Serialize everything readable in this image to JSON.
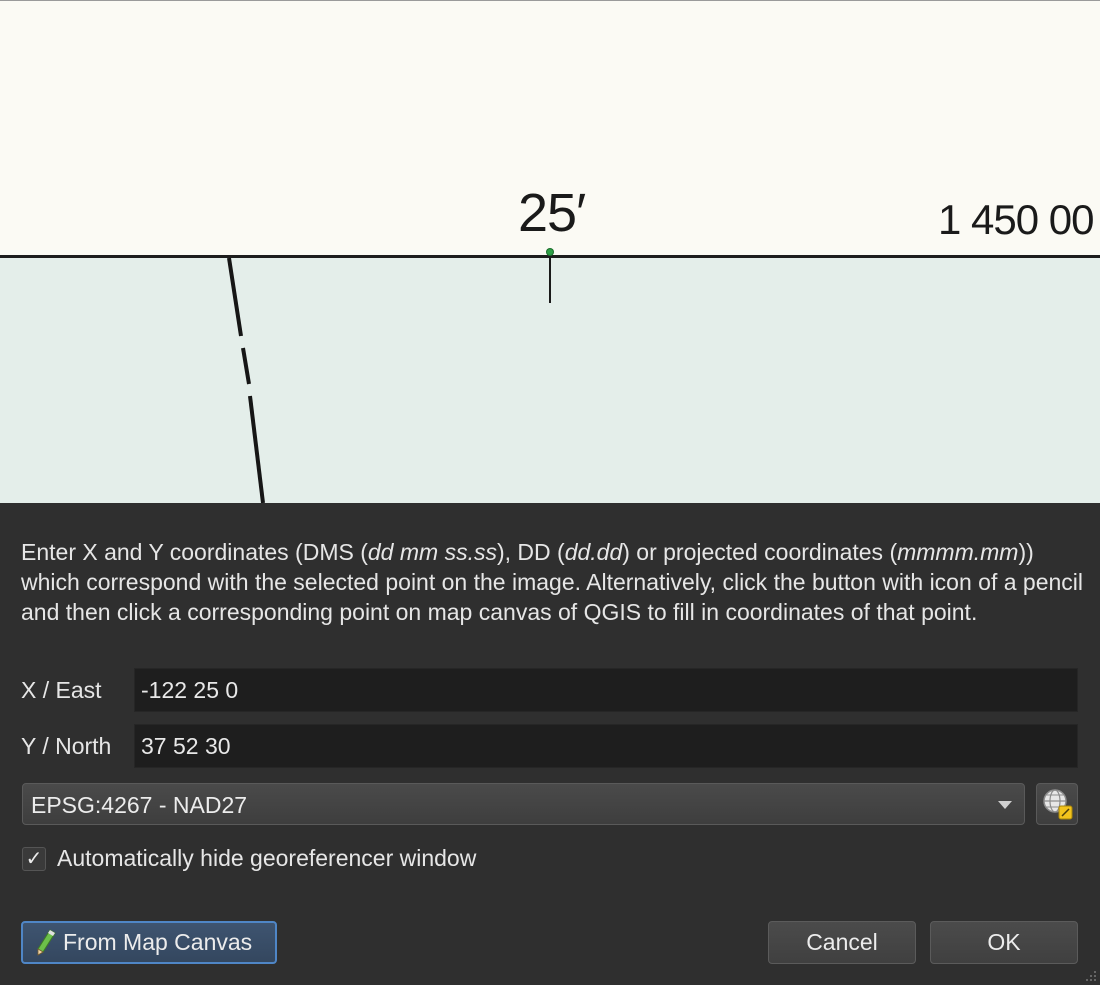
{
  "map": {
    "latitude_tick_label": "25′",
    "easting_label": "1 450 00"
  },
  "dialog": {
    "instructions": {
      "p1": "Enter X and Y coordinates (DMS (",
      "i1": "dd mm ss.ss",
      "p2": "), DD (",
      "i2": "dd.dd",
      "p3": ") or projected coordinates (",
      "i3": "mmmm.mm",
      "p4": ")) which correspond with the selected point on the image. Alternatively, click the button with icon of a pencil and then click a corresponding point on map canvas of QGIS to fill in coordinates of that point."
    },
    "x_label": "X / East",
    "x_value": "-122 25 0",
    "y_label": "Y / North",
    "y_value": "37 52 30",
    "crs": "EPSG:4267 - NAD27",
    "auto_hide_label": "Automatically hide georeferencer window",
    "auto_hide_checked": true,
    "checkmark": "✓",
    "from_map_canvas_label": "From Map Canvas",
    "cancel_label": "Cancel",
    "ok_label": "OK"
  },
  "colors": {
    "accent": "#4f86c6",
    "gcp_point": "#2ea046",
    "map_paper": "#fbfaf4",
    "map_water": "#e4eeea"
  }
}
